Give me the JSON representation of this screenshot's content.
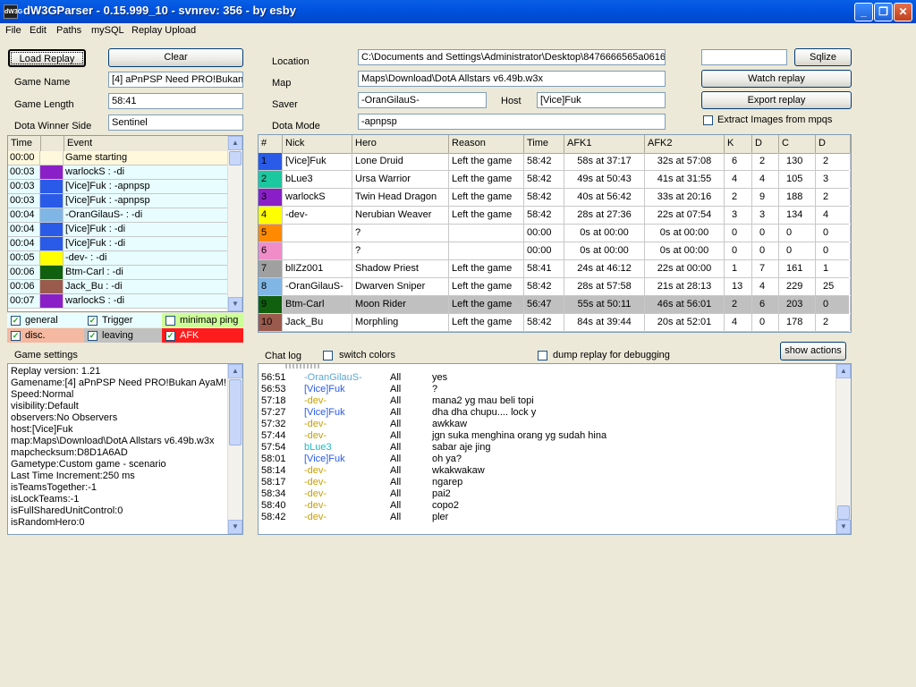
{
  "window": {
    "title": "dW3GParser - 0.15.999_10 - svnrev: 356 - by esby",
    "icon_label": "dW3G"
  },
  "menu": [
    "File",
    "Edit",
    "Paths",
    "mySQL",
    "Replay Upload"
  ],
  "buttons": {
    "load_replay": "Load Replay",
    "clear": "Clear",
    "sqlize": "Sqlize",
    "watch_replay": "Watch replay",
    "export_replay": "Export replay",
    "show_actions": "show actions"
  },
  "game": {
    "name_label": "Game Name",
    "name_value": "[4] aPnPSP Need PRO!Bukan",
    "length_label": "Game Length",
    "length_value": "58:41",
    "winner_label": "Dota Winner Side",
    "winner_value": "Sentinel",
    "location_label": "Location",
    "location_value": "C:\\Documents and Settings\\Administrator\\Desktop\\8476666565a0616",
    "map_label": "Map",
    "map_value": "Maps\\Download\\DotA Allstars v6.49b.w3x",
    "saver_label": "Saver",
    "saver_value": "-OranGilauS-",
    "host_label": "Host",
    "host_value": "[Vice]Fuk",
    "mode_label": "Dota Mode",
    "mode_value": "-apnpsp",
    "sqlize_value": "",
    "extract_label": "Extract Images from mpqs"
  },
  "events": {
    "headers": [
      "Time",
      "Event"
    ],
    "rows": [
      {
        "time": "00:00",
        "color": "#FFF8DC",
        "text": "Game starting"
      },
      {
        "time": "00:03",
        "color": "#8A1FC8",
        "text": "warlockS : -di"
      },
      {
        "time": "00:03",
        "color": "#2A5AE8",
        "text": "[Vice]Fuk : -apnpsp"
      },
      {
        "time": "00:03",
        "color": "#2A5AE8",
        "text": "[Vice]Fuk : -apnpsp"
      },
      {
        "time": "00:04",
        "color": "#7FB6E6",
        "text": "-OranGilauS- : -di"
      },
      {
        "time": "00:04",
        "color": "#2A5AE8",
        "text": "[Vice]Fuk : -di"
      },
      {
        "time": "00:04",
        "color": "#2A5AE8",
        "text": "[Vice]Fuk : -di"
      },
      {
        "time": "00:05",
        "color": "#FFFF00",
        "text": "-dev- : -di"
      },
      {
        "time": "00:06",
        "color": "#106010",
        "text": "Btm-Carl : -di"
      },
      {
        "time": "00:06",
        "color": "#9A5A4C",
        "text": "Jack_Bu : -di"
      },
      {
        "time": "00:07",
        "color": "#8A1FC8",
        "text": "warlockS : -di"
      }
    ]
  },
  "filters": [
    {
      "label": "general",
      "checked": true,
      "bg": "#E8FDFF"
    },
    {
      "label": "Trigger",
      "checked": true,
      "bg": "#E8FDFF"
    },
    {
      "label": "minimap ping",
      "checked": false,
      "bg": "#CCFF99"
    },
    {
      "label": "disc.",
      "checked": true,
      "bg": "#F5B8A0"
    },
    {
      "label": "leaving",
      "checked": true,
      "bg": "#C0C0C0"
    },
    {
      "label": "AFK",
      "checked": true,
      "bg": "#FF1C1C"
    }
  ],
  "players": {
    "headers": [
      "#",
      "Nick",
      "Hero",
      "Reason",
      "Time",
      "AFK1",
      "AFK2",
      "K",
      "D",
      "C",
      "D"
    ],
    "rows": [
      {
        "num": "1",
        "color": "#2A5AE8",
        "nick": "[Vice]Fuk",
        "hero": "Lone Druid",
        "reason": "Left the game",
        "time": "58:42",
        "afk1": "58s at 37:17",
        "afk2": "32s at 57:08",
        "k": "6",
        "d": "2",
        "c": "130",
        "dn": "2"
      },
      {
        "num": "2",
        "color": "#1CC8A0",
        "nick": "bLue3",
        "hero": "Ursa Warrior",
        "reason": "Left the game",
        "time": "58:42",
        "afk1": "49s at 50:43",
        "afk2": "41s at 31:55",
        "k": "4",
        "d": "4",
        "c": "105",
        "dn": "3"
      },
      {
        "num": "3",
        "color": "#8A1FC8",
        "nick": "warlockS",
        "hero": "Twin Head Dragon",
        "reason": "Left the game",
        "time": "58:42",
        "afk1": "40s at 56:42",
        "afk2": "33s at 20:16",
        "k": "2",
        "d": "9",
        "c": "188",
        "dn": "2"
      },
      {
        "num": "4",
        "color": "#FFFF00",
        "nick": "-dev-",
        "hero": "Nerubian Weaver",
        "reason": "Left the game",
        "time": "58:42",
        "afk1": "28s at 27:36",
        "afk2": "22s at 07:54",
        "k": "3",
        "d": "3",
        "c": "134",
        "dn": "4"
      },
      {
        "num": "5",
        "color": "#FF8A00",
        "nick": "",
        "hero": "?",
        "reason": "",
        "time": "00:00",
        "afk1": "0s at 00:00",
        "afk2": "0s at 00:00",
        "k": "0",
        "d": "0",
        "c": "0",
        "dn": "0"
      },
      {
        "num": "6",
        "color": "#F08CC8",
        "nick": "",
        "hero": "?",
        "reason": "",
        "time": "00:00",
        "afk1": "0s at 00:00",
        "afk2": "0s at 00:00",
        "k": "0",
        "d": "0",
        "c": "0",
        "dn": "0"
      },
      {
        "num": "7",
        "color": "#A0A0A0",
        "nick": "blIZz001",
        "hero": "Shadow Priest",
        "reason": "Left the game",
        "time": "58:41",
        "afk1": "24s at 46:12",
        "afk2": "22s at 00:00",
        "k": "1",
        "d": "7",
        "c": "161",
        "dn": "1"
      },
      {
        "num": "8",
        "color": "#7FB6E6",
        "nick": "-OranGilauS-",
        "hero": "Dwarven Sniper",
        "reason": "Left the game",
        "time": "58:42",
        "afk1": "28s at 57:58",
        "afk2": "21s at 28:13",
        "k": "13",
        "d": "4",
        "c": "229",
        "dn": "25"
      },
      {
        "num": "9",
        "color": "#106010",
        "nick": "Btm-Carl",
        "hero": "Moon Rider",
        "reason": "Left the game",
        "time": "56:47",
        "afk1": "55s at 50:11",
        "afk2": "46s at 56:01",
        "k": "2",
        "d": "6",
        "c": "203",
        "dn": "0"
      },
      {
        "num": "10",
        "color": "#9A5A4C",
        "nick": "Jack_Bu",
        "hero": "Morphling",
        "reason": "Left the game",
        "time": "58:42",
        "afk1": "84s at 39:44",
        "afk2": "20s at 52:01",
        "k": "4",
        "d": "0",
        "c": "178",
        "dn": "2"
      }
    ]
  },
  "chat": {
    "label": "Chat log",
    "switch_colors_label": "switch colors",
    "dump_label": "dump replay for debugging",
    "rows": [
      {
        "time": "56:51",
        "nick": "-OranGilauS-",
        "nick_color": "#5AA8D8",
        "scope": "All",
        "msg": "yes"
      },
      {
        "time": "56:53",
        "nick": "[Vice]Fuk",
        "nick_color": "#2A5AE8",
        "scope": "All",
        "msg": "?"
      },
      {
        "time": "57:18",
        "nick": "-dev-",
        "nick_color": "#C8A000",
        "scope": "All",
        "msg": "mana2 yg mau beli topi"
      },
      {
        "time": "57:27",
        "nick": "[Vice]Fuk",
        "nick_color": "#2A5AE8",
        "scope": "All",
        "msg": "dha dha chupu.... lock y"
      },
      {
        "time": "57:32",
        "nick": "-dev-",
        "nick_color": "#C8A000",
        "scope": "All",
        "msg": "awkkaw"
      },
      {
        "time": "57:44",
        "nick": "-dev-",
        "nick_color": "#C8A000",
        "scope": "All",
        "msg": "jgn suka menghina orang yg sudah hina"
      },
      {
        "time": "57:54",
        "nick": "bLue3",
        "nick_color": "#1CB8C0",
        "scope": "All",
        "msg": "sabar aje jing"
      },
      {
        "time": "58:01",
        "nick": "[Vice]Fuk",
        "nick_color": "#2A5AE8",
        "scope": "All",
        "msg": "oh ya?"
      },
      {
        "time": "58:14",
        "nick": "-dev-",
        "nick_color": "#C8A000",
        "scope": "All",
        "msg": "wkakwakaw"
      },
      {
        "time": "58:17",
        "nick": "-dev-",
        "nick_color": "#C8A000",
        "scope": "All",
        "msg": "ngarep"
      },
      {
        "time": "58:34",
        "nick": "-dev-",
        "nick_color": "#C8A000",
        "scope": "All",
        "msg": "pai2"
      },
      {
        "time": "58:40",
        "nick": "-dev-",
        "nick_color": "#C8A000",
        "scope": "All",
        "msg": "copo2"
      },
      {
        "time": "58:42",
        "nick": "-dev-",
        "nick_color": "#C8A000",
        "scope": "All",
        "msg": "pler"
      }
    ]
  },
  "settings": {
    "label": "Game settings",
    "lines": [
      "Replay version: 1.21",
      "Gamename:[4] aPnPSP Need PRO!Bukan AyaM!",
      "Speed:Normal",
      "visibility:Default",
      "observers:No Observers",
      "host:[Vice]Fuk",
      "map:Maps\\Download\\DotA Allstars v6.49b.w3x",
      "mapchecksum:D8D1A6AD",
      "Gametype:Custom game - scenario",
      "Last Time Increment:250 ms",
      "isTeamsTogether:-1",
      "isLockTeams:-1",
      "isFullSharedUnitControl:0",
      "isRandomHero:0"
    ]
  }
}
